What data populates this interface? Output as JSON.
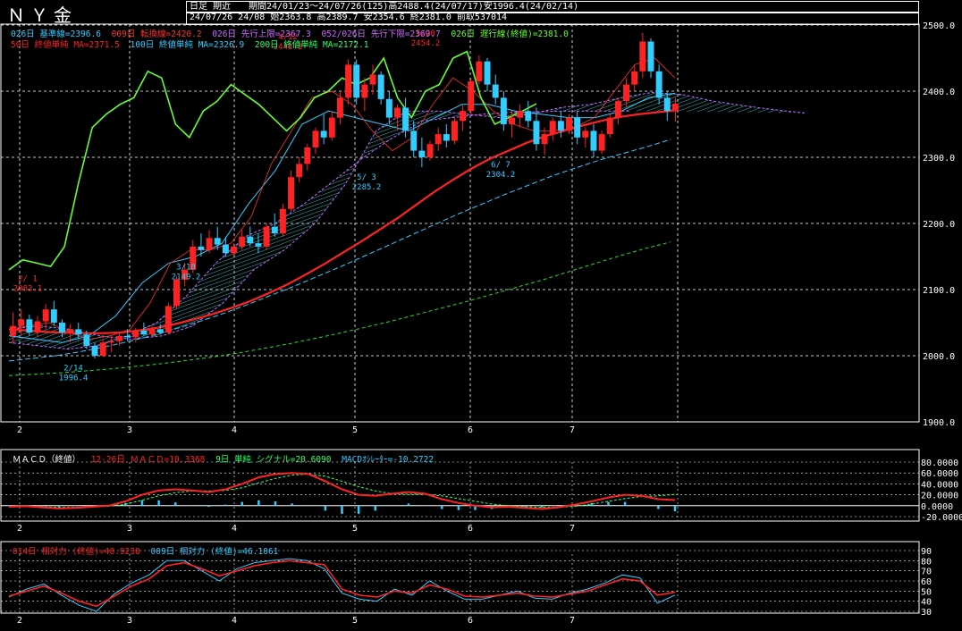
{
  "header": {
    "title": "ＮＹ金",
    "row1": {
      "label": "日足  期近",
      "period_info": "期間24/01/23～24/07/26(125)高2488.4(24/07/17)安1996.4(24/02/14)"
    },
    "row2": "24/07/26 24/08 始2363.8 高2389.7 安2354.6 終2381.0 前取537014"
  },
  "legend_main": {
    "row1": [
      {
        "text": "026日 基準線=2396.6",
        "color": "#33ccff"
      },
      {
        "text": "009日 転換線=2420.2",
        "color": "#ff3333"
      },
      {
        "text": "026日 先行上限=2367.3",
        "color": "#cc66ff"
      },
      {
        "text": "052/026日 先行下限=2369.7",
        "color": "#cc66ff"
      },
      {
        "text": "026日 遅行線(終値)=2381.0",
        "color": "#66ff33"
      }
    ],
    "row2": [
      {
        "text": "50日 終値単純 MA=2371.5",
        "color": "#ff2222"
      },
      {
        "text": "100日 終値単純 MA=2326.9",
        "color": "#33ccff"
      },
      {
        "text": "200日 終値単純 MA=2172.1",
        "color": "#33ff66"
      }
    ]
  },
  "legend_macd": [
    {
      "text": "ＭＡＣＤ（終値）",
      "color": "#ffffff"
    },
    {
      "text": "12-26日 ＭＡＣＤ=10.3368",
      "color": "#ff2222"
    },
    {
      "text": "9日 単純 シグナル=20.6090",
      "color": "#33ff66"
    },
    {
      "text": "MACDｵｼﾚｰﾀｰ=-10.2722",
      "color": "#33ccff"
    }
  ],
  "legend_rsi": [
    {
      "text": "014日 相対力 (終値)=48.9238",
      "color": "#ff2222"
    },
    {
      "text": "009日 相対力 (終値)=46.1061",
      "color": "#33ccff"
    }
  ],
  "colors": {
    "up": "#ff2222",
    "down": "#33ccff",
    "ma50": "#ff2222",
    "ma100": "#33ccff",
    "ma200": "#22dd22",
    "chikou": "#66ff33",
    "tenkan": "#ff3333",
    "kijun": "#33ccff",
    "spanA": "#cc66ff",
    "spanB": "#cc66ff",
    "kumo": "#33dddd",
    "grid": "#ffffff"
  },
  "chart_data": [
    {
      "type": "candlestick",
      "title": "ＮＹ金",
      "x_ticks": [
        "2",
        "3",
        "4",
        "5",
        "6",
        "7"
      ],
      "y_ticks": [
        "1900.0",
        "2000.0",
        "2100.0",
        "2200.0",
        "2300.0",
        "2400.0",
        "2500.0"
      ],
      "ylim": [
        1900,
        2500
      ],
      "annotations": [
        {
          "label": "2/ 1",
          "value": "2083.1",
          "kind": "high"
        },
        {
          "label": "2/14",
          "value": "1996.4",
          "kind": "low"
        },
        {
          "label": "3/18",
          "value": "2149.2",
          "kind": "low"
        },
        {
          "label": "4/12",
          "value": "2448.8",
          "kind": "high"
        },
        {
          "label": "5/ 3",
          "value": "2285.2",
          "kind": "low"
        },
        {
          "label": "5/20",
          "value": "2454.2",
          "kind": "high"
        },
        {
          "label": "6/ 7",
          "value": "2304.2",
          "kind": "low"
        }
      ],
      "ohlc": [
        [
          2030,
          2065,
          2018,
          2045
        ],
        [
          2045,
          2070,
          2030,
          2055
        ],
        [
          2055,
          2062,
          2030,
          2035
        ],
        [
          2035,
          2060,
          2028,
          2052
        ],
        [
          2052,
          2078,
          2040,
          2070
        ],
        [
          2070,
          2083,
          2045,
          2050
        ],
        [
          2050,
          2055,
          2028,
          2035
        ],
        [
          2035,
          2048,
          2020,
          2040
        ],
        [
          2040,
          2050,
          2025,
          2032
        ],
        [
          2032,
          2038,
          2010,
          2015
        ],
        [
          2015,
          2020,
          1996,
          2000
        ],
        [
          2000,
          2025,
          1998,
          2020
        ],
        [
          2020,
          2030,
          2005,
          2022
        ],
        [
          2022,
          2035,
          2015,
          2030
        ],
        [
          2030,
          2040,
          2022,
          2028
        ],
        [
          2028,
          2042,
          2020,
          2038
        ],
        [
          2038,
          2050,
          2030,
          2032
        ],
        [
          2032,
          2045,
          2028,
          2040
        ],
        [
          2040,
          2048,
          2032,
          2035
        ],
        [
          2035,
          2080,
          2032,
          2075
        ],
        [
          2075,
          2120,
          2070,
          2115
        ],
        [
          2115,
          2140,
          2105,
          2130
        ],
        [
          2130,
          2175,
          2125,
          2165
        ],
        [
          2165,
          2185,
          2150,
          2160
        ],
        [
          2160,
          2190,
          2155,
          2178
        ],
        [
          2178,
          2195,
          2160,
          2168
        ],
        [
          2168,
          2180,
          2150,
          2155
        ],
        [
          2155,
          2170,
          2149,
          2165
        ],
        [
          2165,
          2190,
          2160,
          2180
        ],
        [
          2180,
          2195,
          2165,
          2170
        ],
        [
          2170,
          2185,
          2155,
          2165
        ],
        [
          2165,
          2200,
          2160,
          2195
        ],
        [
          2195,
          2215,
          2180,
          2185
        ],
        [
          2185,
          2230,
          2180,
          2222
        ],
        [
          2222,
          2280,
          2218,
          2270
        ],
        [
          2270,
          2300,
          2262,
          2290
        ],
        [
          2290,
          2320,
          2280,
          2315
        ],
        [
          2315,
          2345,
          2305,
          2340
        ],
        [
          2340,
          2365,
          2320,
          2330
        ],
        [
          2330,
          2370,
          2325,
          2360
        ],
        [
          2360,
          2400,
          2350,
          2390
        ],
        [
          2390,
          2448,
          2380,
          2440
        ],
        [
          2440,
          2448,
          2380,
          2390
        ],
        [
          2390,
          2420,
          2370,
          2410
        ],
        [
          2410,
          2440,
          2395,
          2425
        ],
        [
          2425,
          2430,
          2380,
          2388
        ],
        [
          2388,
          2400,
          2350,
          2360
        ],
        [
          2360,
          2380,
          2340,
          2375
        ],
        [
          2375,
          2390,
          2330,
          2340
        ],
        [
          2340,
          2355,
          2300,
          2310
        ],
        [
          2310,
          2330,
          2285,
          2300
        ],
        [
          2300,
          2325,
          2295,
          2320
        ],
        [
          2320,
          2345,
          2310,
          2335
        ],
        [
          2335,
          2350,
          2315,
          2325
        ],
        [
          2325,
          2360,
          2320,
          2355
        ],
        [
          2355,
          2380,
          2340,
          2370
        ],
        [
          2370,
          2420,
          2365,
          2415
        ],
        [
          2415,
          2454,
          2410,
          2445
        ],
        [
          2445,
          2450,
          2400,
          2410
        ],
        [
          2410,
          2425,
          2380,
          2390
        ],
        [
          2390,
          2400,
          2340,
          2350
        ],
        [
          2350,
          2370,
          2330,
          2360
        ],
        [
          2360,
          2380,
          2345,
          2370
        ],
        [
          2370,
          2385,
          2345,
          2355
        ],
        [
          2355,
          2375,
          2310,
          2320
        ],
        [
          2320,
          2345,
          2304,
          2335
        ],
        [
          2335,
          2360,
          2325,
          2355
        ],
        [
          2355,
          2370,
          2330,
          2340
        ],
        [
          2340,
          2365,
          2335,
          2360
        ],
        [
          2360,
          2370,
          2320,
          2330
        ],
        [
          2330,
          2345,
          2315,
          2340
        ],
        [
          2340,
          2350,
          2300,
          2310
        ],
        [
          2310,
          2340,
          2305,
          2335
        ],
        [
          2335,
          2365,
          2330,
          2360
        ],
        [
          2360,
          2390,
          2350,
          2385
        ],
        [
          2385,
          2420,
          2375,
          2410
        ],
        [
          2410,
          2440,
          2400,
          2430
        ],
        [
          2430,
          2488,
          2420,
          2475
        ],
        [
          2475,
          2480,
          2420,
          2430
        ],
        [
          2430,
          2440,
          2380,
          2390
        ],
        [
          2390,
          2400,
          2355,
          2370
        ],
        [
          2370,
          2390,
          2354,
          2381
        ]
      ],
      "series": [
        {
          "name": "50日 終値単純 MA",
          "values": [
            2040,
            2038,
            2036,
            2035,
            2034,
            2034,
            2035,
            2038,
            2042,
            2048,
            2055,
            2063,
            2072,
            2082,
            2094,
            2107,
            2122,
            2138,
            2155,
            2172,
            2190,
            2208,
            2228,
            2248,
            2266,
            2283,
            2298,
            2310,
            2322,
            2332,
            2340,
            2348,
            2355,
            2361,
            2365,
            2368,
            2371
          ]
        },
        {
          "name": "100日 終値単純 MA",
          "values": [
            1992,
            1996,
            2000,
            2006,
            2013,
            2021,
            2030,
            2040,
            2051,
            2063,
            2076,
            2090,
            2104,
            2119,
            2134,
            2150,
            2166,
            2182,
            2198,
            2214,
            2229,
            2244,
            2258,
            2272,
            2284,
            2296,
            2306,
            2316,
            2327
          ]
        },
        {
          "name": "200日 終値単純 MA",
          "values": [
            1970,
            1972,
            1974,
            1977,
            1980,
            1984,
            1988,
            1993,
            1998,
            2004,
            2011,
            2018,
            2026,
            2034,
            2043,
            2052,
            2062,
            2072,
            2082,
            2093,
            2104,
            2115,
            2127,
            2139,
            2151,
            2162,
            2172
          ]
        },
        {
          "name": "026日 遅行線(終値)",
          "values": [
            2130,
            2145,
            2140,
            2135,
            2165,
            2260,
            2345,
            2365,
            2380,
            2390,
            2430,
            2420,
            2350,
            2330,
            2370,
            2385,
            2410,
            2395,
            2380,
            2360,
            2340,
            2360,
            2390,
            2400,
            2420,
            2410,
            2420,
            2450,
            2390,
            2360,
            2400,
            2410,
            2450,
            2460,
            2390,
            2350,
            2360,
            2370,
            2381
          ]
        }
      ],
      "ichimoku": {
        "tenkan": [
          2040,
          2045,
          2050,
          2035,
          2025,
          2030,
          2040,
          2080,
          2140,
          2160,
          2160,
          2170,
          2210,
          2290,
          2340,
          2390,
          2400,
          2380,
          2340,
          2310,
          2330,
          2380,
          2420,
          2400,
          2370,
          2350,
          2340,
          2340,
          2345,
          2360,
          2400,
          2440,
          2450,
          2420
        ],
        "kijun": [
          2030,
          2025,
          2020,
          2030,
          2060,
          2110,
          2140,
          2150,
          2170,
          2230,
          2280,
          2350,
          2370,
          2360,
          2350,
          2340,
          2360,
          2380,
          2380,
          2370,
          2365,
          2360,
          2360,
          2370,
          2390,
          2397
        ],
        "spanA": [
          2040,
          2045,
          2040,
          2030,
          2025,
          2030,
          2045,
          2080,
          2130,
          2160,
          2200,
          2260,
          2340,
          2370,
          2370,
          2365,
          2360,
          2365,
          2375,
          2380,
          2390,
          2398,
          2395,
          2385,
          2378,
          2372,
          2367
        ],
        "spanB": [
          2020,
          2015,
          2010,
          2015,
          2030,
          2050,
          2090,
          2140,
          2180,
          2200,
          2230,
          2265,
          2300,
          2330,
          2355,
          2360,
          2365,
          2368,
          2369,
          2370,
          2370,
          2370
        ]
      }
    },
    {
      "type": "line",
      "title": "ＭＡＣＤ（終値）",
      "y_ticks": [
        "-20.0000",
        "0.0000",
        "20.0000",
        "40.0000",
        "60.0000",
        "80.0000"
      ],
      "ylim": [
        -20,
        80
      ],
      "series": [
        {
          "name": "12-26日 ＭＡＣＤ",
          "values": [
            -2,
            -1,
            -3,
            -5,
            -4,
            -2,
            0,
            8,
            20,
            28,
            30,
            28,
            25,
            30,
            40,
            52,
            58,
            60,
            58,
            45,
            30,
            20,
            18,
            22,
            25,
            22,
            12,
            5,
            0,
            -3,
            -2,
            -4,
            -6,
            -3,
            2,
            8,
            15,
            20,
            18,
            12,
            10.3
          ]
        },
        {
          "name": "9日 単純 シグナル",
          "values": [
            -1,
            -2,
            -2,
            -3,
            -3,
            -2,
            -1,
            3,
            10,
            18,
            24,
            27,
            27,
            28,
            33,
            42,
            50,
            56,
            58,
            54,
            45,
            35,
            27,
            22,
            21,
            21,
            18,
            13,
            8,
            3,
            0,
            -2,
            -3,
            -3,
            -1,
            3,
            8,
            13,
            17,
            18,
            20.6
          ]
        },
        {
          "name": "MACDｵｼﾚｰﾀｰ",
          "values": [
            -1,
            1,
            -1,
            -2,
            -1,
            0,
            1,
            5,
            10,
            10,
            6,
            1,
            -2,
            2,
            7,
            10,
            8,
            4,
            0,
            -9,
            -15,
            -15,
            -9,
            0,
            4,
            1,
            -6,
            -8,
            -8,
            -6,
            -2,
            -2,
            -3,
            0,
            3,
            5,
            7,
            7,
            1,
            -6,
            -10.3
          ]
        }
      ]
    },
    {
      "type": "line",
      "title": "相対力",
      "y_ticks": [
        "30",
        "40",
        "50",
        "60",
        "70",
        "80",
        "90"
      ],
      "ylim": [
        30,
        90
      ],
      "series": [
        {
          "name": "014日 相対力 (終値)",
          "values": [
            45,
            50,
            55,
            48,
            40,
            35,
            45,
            55,
            62,
            75,
            78,
            72,
            65,
            70,
            75,
            78,
            80,
            78,
            76,
            52,
            46,
            44,
            50,
            48,
            56,
            52,
            45,
            44,
            46,
            48,
            45,
            44,
            47,
            50,
            56,
            62,
            60,
            46,
            48.9
          ]
        },
        {
          "name": "009日 相対力 (終値)",
          "values": [
            44,
            52,
            57,
            46,
            36,
            30,
            47,
            58,
            66,
            80,
            80,
            70,
            60,
            72,
            78,
            80,
            82,
            80,
            72,
            48,
            42,
            40,
            52,
            46,
            60,
            50,
            42,
            42,
            46,
            50,
            43,
            42,
            48,
            52,
            58,
            66,
            63,
            38,
            46.1
          ]
        }
      ]
    }
  ]
}
